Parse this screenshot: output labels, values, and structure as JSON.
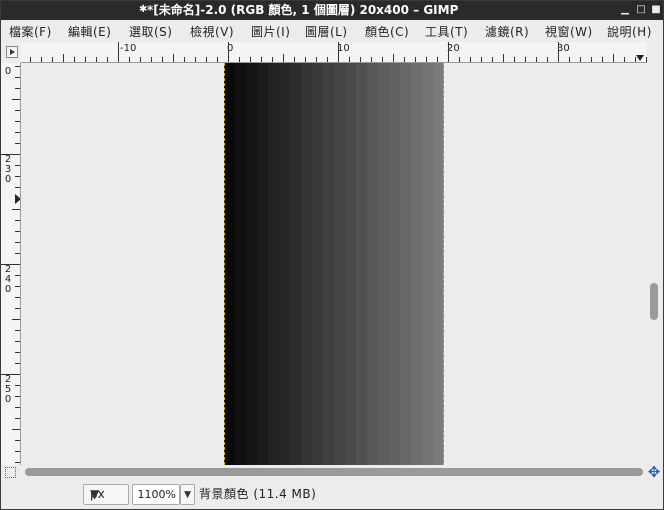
{
  "window": {
    "title": "*[未命名]-2.0 (RGB 顏色, 1 個圖層) 20x400 – GIMP",
    "title_icon": "modified-icon",
    "buttons": [
      "minimize",
      "maximize",
      "close"
    ]
  },
  "menubar": {
    "items": [
      {
        "label": "檔案(F)"
      },
      {
        "label": "編輯(E)"
      },
      {
        "label": "選取(S)"
      },
      {
        "label": "檢視(V)"
      },
      {
        "label": "圖片(I)"
      },
      {
        "label": "圖層(L)"
      },
      {
        "label": "顏色(C)"
      },
      {
        "label": "工具(T)"
      },
      {
        "label": "濾鏡(R)"
      },
      {
        "label": "視窗(W)"
      },
      {
        "label": "說明(H)"
      }
    ]
  },
  "rulers": {
    "horizontal_labels": [
      "-10",
      "0",
      "10",
      "20",
      "30"
    ],
    "vertical_labels": [
      "0",
      "230",
      "240",
      "250"
    ]
  },
  "canvas": {
    "image_size": "20x400",
    "gradient": {
      "start_color": "#0a0a0a",
      "end_color": "#7a7a7a",
      "stripe_count": 20
    },
    "boundary_color": "#c8b800",
    "background": "#ececec"
  },
  "statusbar": {
    "unit": "px",
    "zoom": "1100%",
    "message": "背景顏色 (11.4 MB)"
  },
  "icons": {
    "ruler_corner": "ruler-menu-icon",
    "quick_mask": "quick-mask-icon",
    "navigate": "navigate-icon"
  }
}
